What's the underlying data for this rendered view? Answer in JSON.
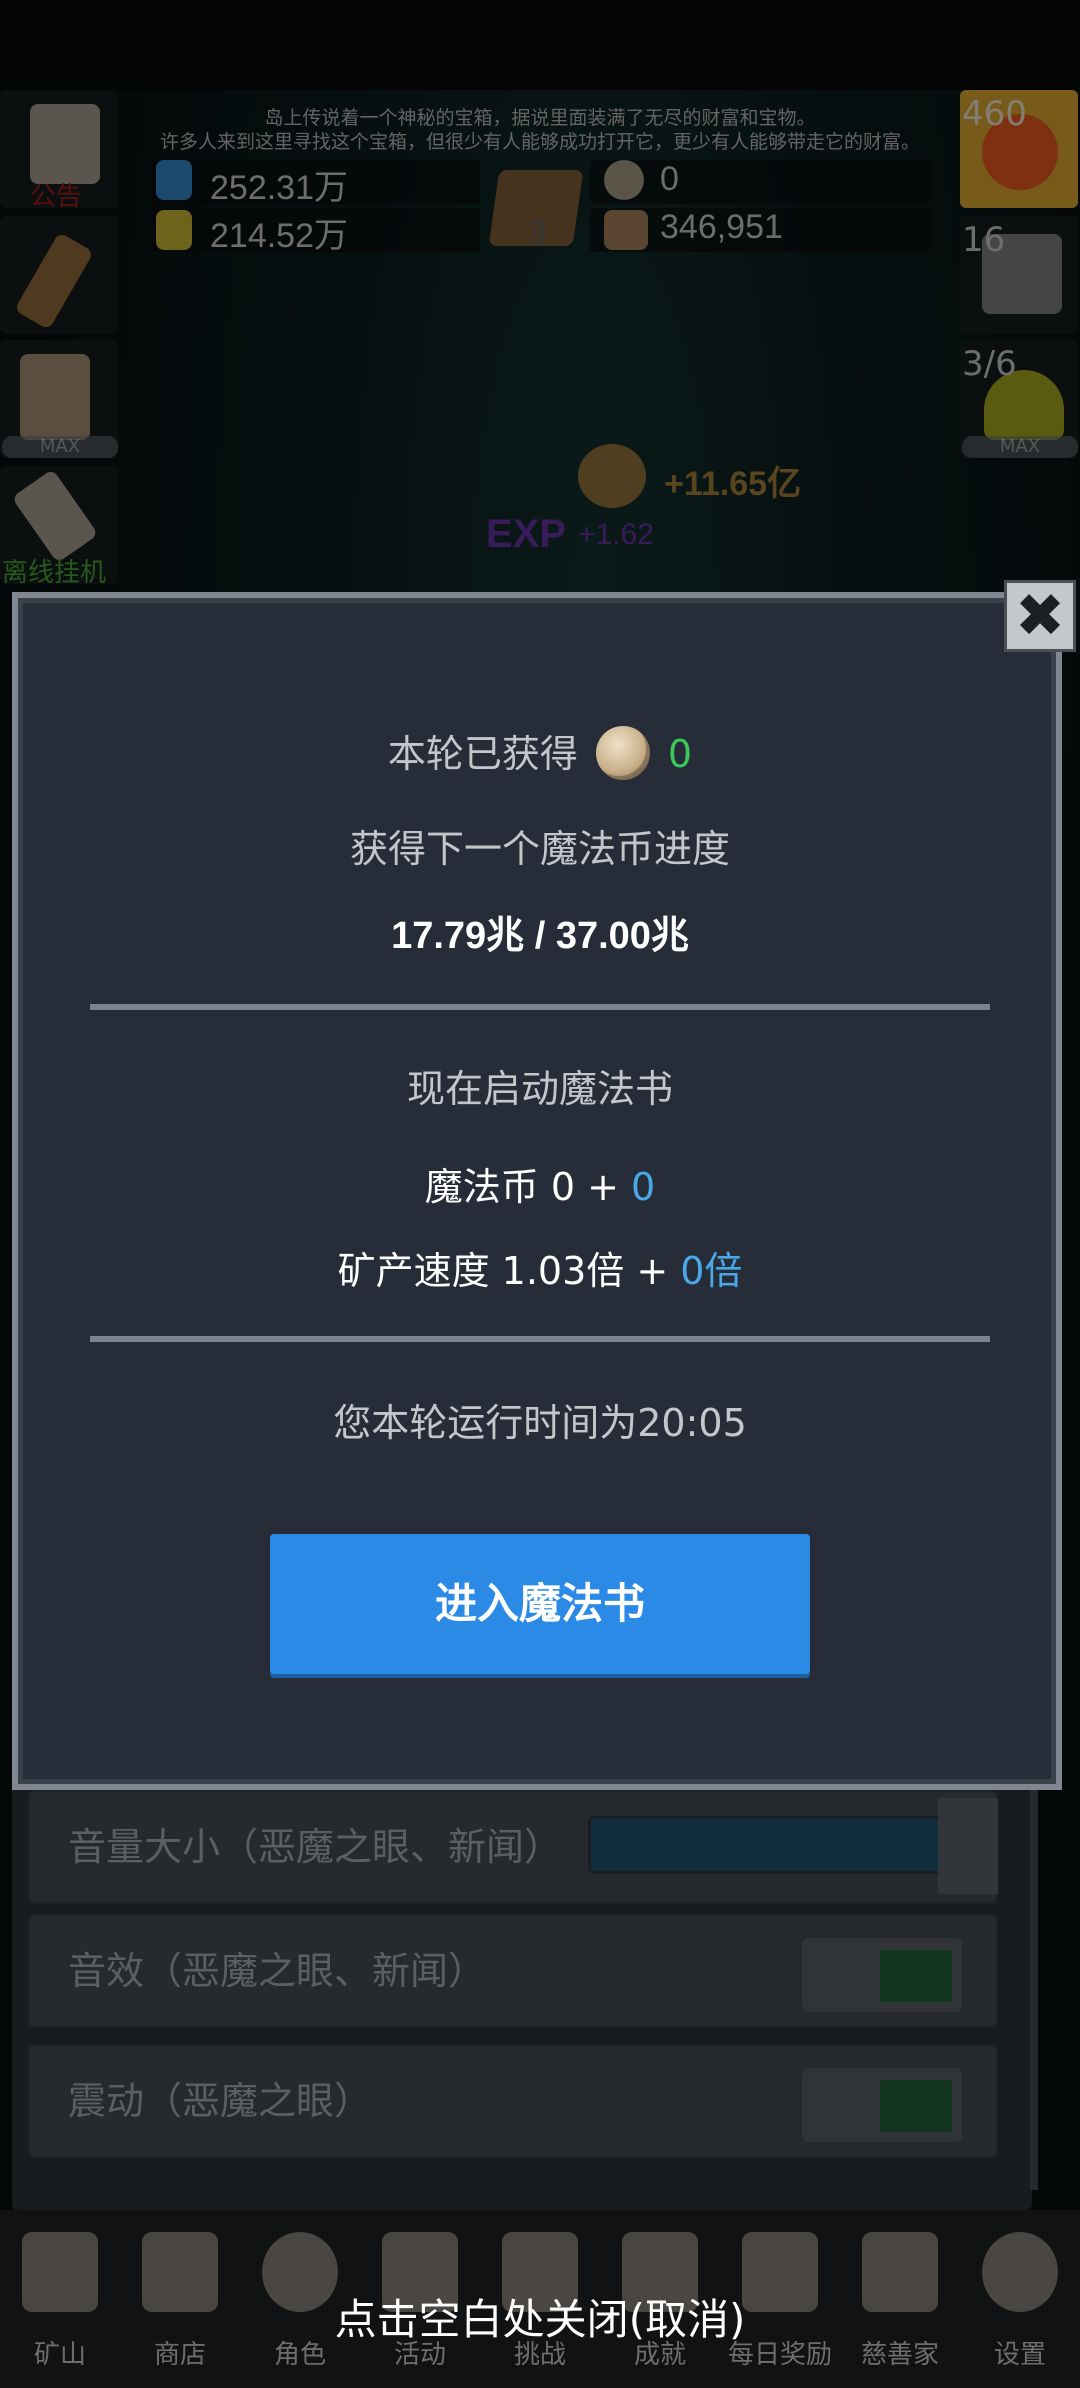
{
  "news": {
    "line1": "岛上传说着一个神秘的宝箱，据说里面装满了无尽的财富和宝物。",
    "line2": "许多人来到这里寻找这个宝箱，但很少有人能够成功打开它，更少有人能够带走它的财富。"
  },
  "resources": {
    "blue_potion": "252.31万",
    "gold_potion": "214.52万",
    "book_count": "3",
    "coin": "0",
    "ore": "346,951"
  },
  "left_buttons": {
    "notice_label": "公告",
    "offline_label": "离线挂机",
    "max_label": "MAX"
  },
  "right_buttons": {
    "potion_count": "460",
    "chest_count": "16",
    "slime_count": "3/6",
    "max_label": "MAX"
  },
  "floating": {
    "gold_gain": "+11.65亿",
    "exp_label": "EXP",
    "exp_gain": "+1.62"
  },
  "modal": {
    "earned_label": "本轮已获得",
    "earned_value": "0",
    "next_coin_progress_label": "获得下一个魔法币进度",
    "progress_value": "17.79兆 / 37.00兆",
    "start_now_label": "现在启动魔法书",
    "magic_coin_label": "魔法币 0 + ",
    "magic_coin_bonus": "0",
    "mining_speed_label": "矿产速度 1.03倍 + ",
    "mining_speed_bonus": "0倍",
    "runtime_label": "您本轮运行时间为20:05",
    "enter_button": "进入魔法书",
    "close_icon": "close-icon"
  },
  "settings": {
    "volume_label": "音量大小（恶魔之眼、新闻）",
    "sfx_label": "音效（恶魔之眼、新闻）",
    "vibration_label": "震动（恶魔之眼）"
  },
  "bottom_nav": [
    {
      "label": "矿山",
      "icon": "lantern-icon"
    },
    {
      "label": "商店",
      "icon": "shell-icon"
    },
    {
      "label": "角色",
      "icon": "skull-icon"
    },
    {
      "label": "活动",
      "icon": "scroll-icon"
    },
    {
      "label": "挑战",
      "icon": "map-icon"
    },
    {
      "label": "成就",
      "icon": "key-icon"
    },
    {
      "label": "每日奖励",
      "icon": "letter-icon"
    },
    {
      "label": "慈善家",
      "icon": "bread-icon"
    },
    {
      "label": "设置",
      "icon": "gear-icon"
    }
  ],
  "hint": "点击空白处关闭(取消)",
  "colors": {
    "accent_blue": "#2a8ae6",
    "green": "#3cc75a",
    "bonus_blue": "#4aa8e8",
    "modal_bg": "#262d38"
  }
}
